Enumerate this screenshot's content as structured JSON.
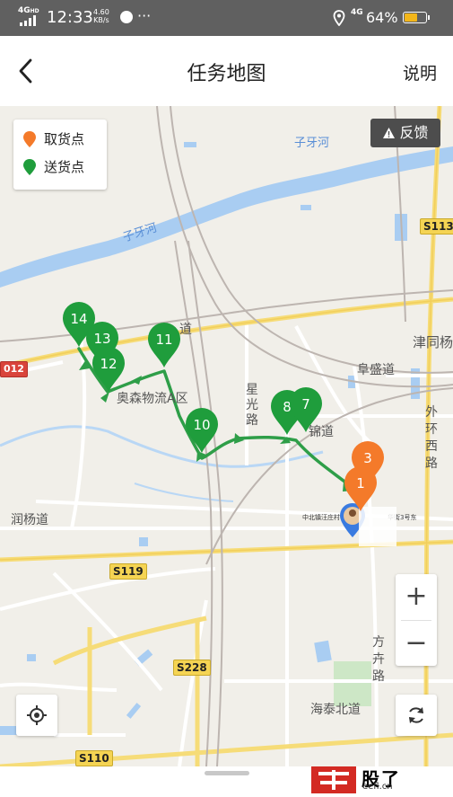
{
  "status_bar": {
    "network_top": "4G",
    "network_sub": "HD",
    "time": "12:33",
    "speed_value": "4.60",
    "speed_unit": "KB/s",
    "more": "···",
    "sim_net": "4G",
    "battery_percent": "64%",
    "battery_level": 0.64
  },
  "header": {
    "title": "任务地图",
    "help_label": "说明"
  },
  "legend": {
    "pickup_label": "取货点",
    "delivery_label": "送货点",
    "pickup_color": "#f47a2a",
    "delivery_color": "#1f9d3c"
  },
  "feedback_label": "反馈",
  "zoom": {
    "in_label": "+",
    "out_label": "−"
  },
  "pins": {
    "delivery": [
      "14",
      "13",
      "12",
      "11",
      "10",
      "8",
      "7"
    ],
    "pickup": [
      "3",
      "1"
    ]
  },
  "map_labels": {
    "river1": "子牙河",
    "river2": "子牙河",
    "road_daodao": "道",
    "road_tiandao": "津同杨",
    "fusheng": "阜盛道",
    "aosen": "奥森物流A区",
    "xingguang": "星光路",
    "jindao": "锦道",
    "waihuan": "外环西路",
    "runyang": "润杨道",
    "fanghui": "方卉路",
    "haitai": "海泰北道",
    "road_s113": "S113",
    "road_012": "012",
    "road_s119": "S119",
    "road_s228": "S228",
    "road_s110": "S110",
    "tiny_poi": "中北镇汪庄村",
    "tiny_poi2": "华街3号东"
  },
  "watermark": {
    "domain": "eefl.cn",
    "text": "股了"
  }
}
